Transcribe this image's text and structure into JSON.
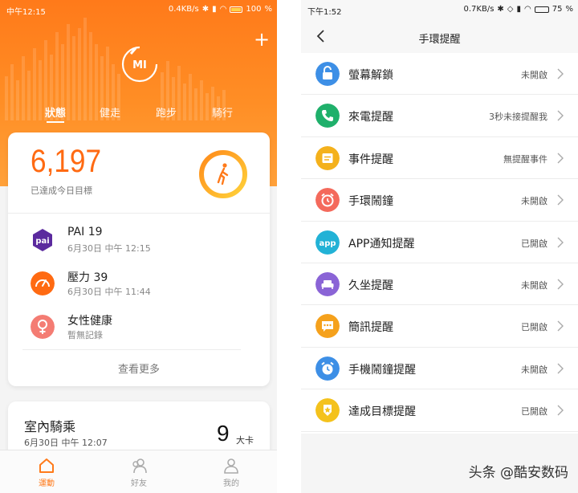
{
  "left": {
    "status": {
      "time": "中午12:15",
      "speed": "0.4KB/s",
      "battery": "100"
    },
    "tabs": [
      "狀態",
      "健走",
      "跑步",
      "騎行"
    ],
    "logo": "MI",
    "summary": {
      "steps": "6,197",
      "subtitle": "已達成今日目標"
    },
    "items": [
      {
        "icon": "pai-icon",
        "title": "PAI 19",
        "subtitle": "6月30日 中午 12:15",
        "color": "#5b2a9e"
      },
      {
        "icon": "stress-gauge-icon",
        "title": "壓力 39",
        "subtitle": "6月30日 中午 11:44",
        "color": "#ff6a12"
      },
      {
        "icon": "female-health-icon",
        "title": "女性健康",
        "subtitle": "暫無記錄",
        "color": "#f47c73"
      }
    ],
    "more": "查看更多",
    "activity": {
      "title": "室內騎乘",
      "date": "6月30日 中午 12:07",
      "value": "9",
      "unit": "大卡"
    },
    "nav": [
      "運動",
      "好友",
      "我的"
    ],
    "pai_badge": "pai",
    "accent": "#ff7a1a"
  },
  "right": {
    "status": {
      "time": "下午1:52",
      "speed": "0.7KB/s",
      "battery": "75"
    },
    "title": "手環提醒",
    "rows": [
      {
        "icon": "unlock-icon",
        "label": "螢幕解鎖",
        "value": "未開啟",
        "color": "#3d8fe6"
      },
      {
        "icon": "phone-icon",
        "label": "來電提醒",
        "value": "3秒未接提醒我",
        "color": "#1fb06b"
      },
      {
        "icon": "calendar-icon",
        "label": "事件提醒",
        "value": "無提醒事件",
        "color": "#f4b11c"
      },
      {
        "icon": "alarm-icon",
        "label": "手環鬧鐘",
        "value": "未開啟",
        "color": "#f46a5c"
      },
      {
        "icon": "app-icon",
        "label": "APP通知提醒",
        "value": "已開啟",
        "color": "#22b2d6"
      },
      {
        "icon": "sofa-icon",
        "label": "久坐提醒",
        "value": "未開啟",
        "color": "#8a64d6"
      },
      {
        "icon": "message-icon",
        "label": "簡訊提醒",
        "value": "已開啟",
        "color": "#f5a11c"
      },
      {
        "icon": "phone-alarm-icon",
        "label": "手機鬧鐘提醒",
        "value": "未開啟",
        "color": "#3d8fe6"
      },
      {
        "icon": "goal-badge-icon",
        "label": "達成目標提醒",
        "value": "已開啟",
        "color": "#f4c21c"
      }
    ],
    "app_badge": "app",
    "watermark": "头条 @酷安数码"
  }
}
